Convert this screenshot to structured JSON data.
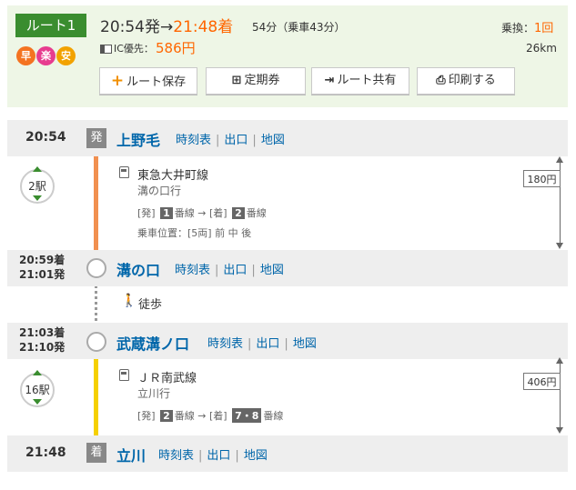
{
  "summary": {
    "route_label": "ルート1",
    "depart": "20:54発",
    "arrow": "→",
    "arrive": "21:48着",
    "duration": "54分（乗車43分）",
    "badges": [
      "早",
      "楽",
      "安"
    ],
    "ic_label": "IC優先：",
    "fare": "586円",
    "transfer_label": "乗換：",
    "transfer_count": "1回",
    "distance": "26km"
  },
  "buttons": {
    "save": "ルート保存",
    "pass": "定期券",
    "share": "ルート共有",
    "print": "印刷する"
  },
  "links": {
    "timetable": "時刻表",
    "exit": "出口",
    "map": "地図"
  },
  "stops": [
    {
      "tag": "発",
      "time": "20:54",
      "name": "上野毛"
    },
    {
      "arr": "20:59着",
      "dep": "21:01発",
      "name": "溝の口"
    },
    {
      "arr": "21:03着",
      "dep": "21:10発",
      "name": "武蔵溝ノ口"
    },
    {
      "tag": "着",
      "time": "21:48",
      "name": "立川"
    }
  ],
  "segments": [
    {
      "count": "2駅",
      "line": "東急大井町線",
      "dest": "溝の口行",
      "dep_label": "[発]",
      "dep_track": "1",
      "track_suffix": "番線",
      "arrow": "→",
      "arr_label": "[着]",
      "arr_track": "2",
      "position": "乗車位置：[5両] 前 中 後",
      "fare": "180円",
      "color": "#f19050"
    },
    {
      "walk": "徒歩"
    },
    {
      "count": "16駅",
      "line": "ＪＲ南武線",
      "dest": "立川行",
      "dep_label": "[発]",
      "dep_track": "2",
      "track_suffix": "番線",
      "arrow": "→",
      "arr_label": "[着]",
      "arr_track": "7・8",
      "fare": "406円",
      "color": "#f5d000"
    }
  ]
}
